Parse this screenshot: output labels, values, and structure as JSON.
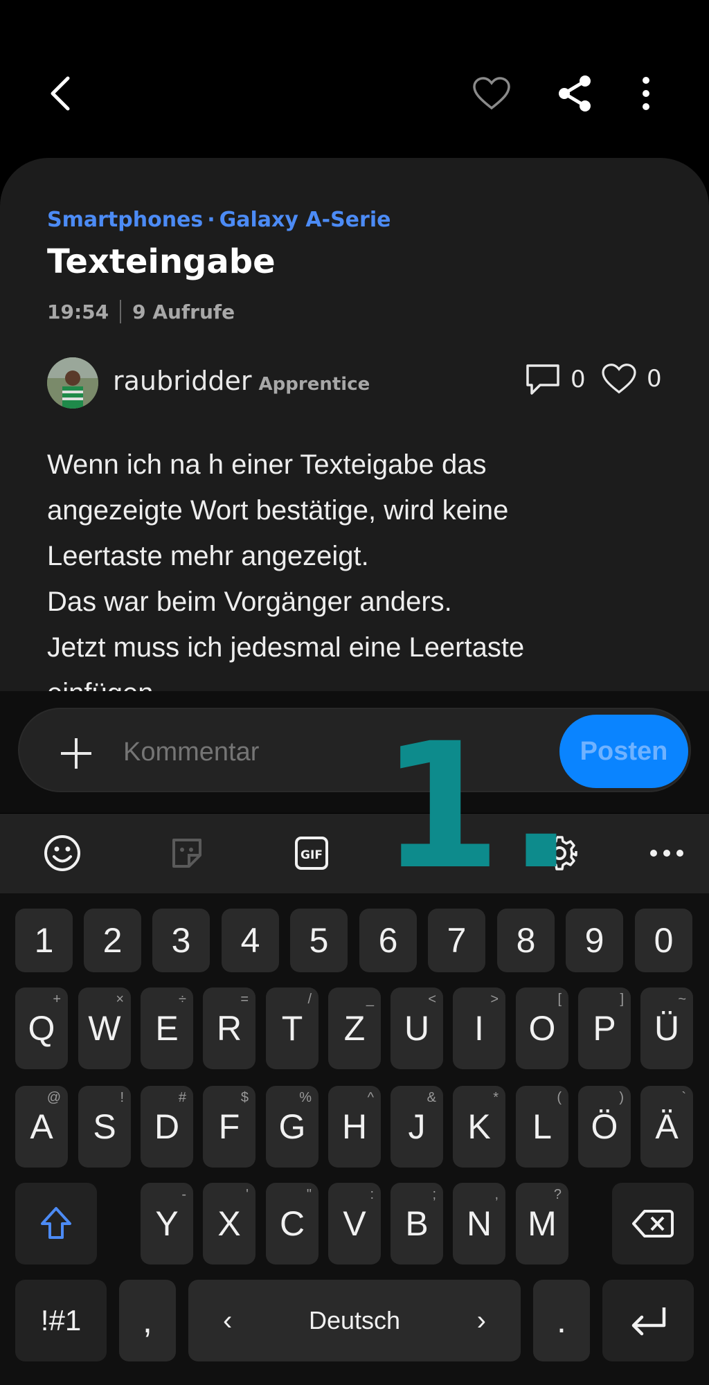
{
  "header": {
    "back_icon": "chevron-left-icon",
    "favorite_icon": "heart-outline-icon",
    "share_icon": "share-icon",
    "more_icon": "more-vertical-icon"
  },
  "post": {
    "breadcrumb": [
      "Smartphones",
      "Galaxy A-Serie"
    ],
    "breadcrumb_separator": "·",
    "title": "Texteingabe",
    "time": "19:54",
    "views": "9 Aufrufe",
    "author": {
      "name": "raubridder",
      "rank": "Apprentice"
    },
    "comments_count": "0",
    "likes_count": "0",
    "body_lines": [
      "Wenn ich na h einer Texteigabe das",
      "angezeigte Wort bestätige, wird keine",
      "Leertaste mehr angezeigt.",
      "Das war beim Vorgänger anders.",
      "Jetzt muss ich jedesmal eine Leertaste",
      "einfügen."
    ]
  },
  "comment_bar": {
    "placeholder": "Kommentar",
    "post_label": "Posten"
  },
  "annotation": "1.",
  "keyboard": {
    "toolbar": [
      "emoji-icon",
      "sticker-icon",
      "gif-icon",
      "settings-icon",
      "more-horizontal-icon"
    ],
    "gif_label": "GIF",
    "number_row": [
      "1",
      "2",
      "3",
      "4",
      "5",
      "6",
      "7",
      "8",
      "9",
      "0"
    ],
    "row1": [
      {
        "k": "Q",
        "s": "+"
      },
      {
        "k": "W",
        "s": "×"
      },
      {
        "k": "E",
        "s": "÷"
      },
      {
        "k": "R",
        "s": "="
      },
      {
        "k": "T",
        "s": "/"
      },
      {
        "k": "Z",
        "s": "_"
      },
      {
        "k": "U",
        "s": "<"
      },
      {
        "k": "I",
        "s": ">"
      },
      {
        "k": "O",
        "s": "["
      },
      {
        "k": "P",
        "s": "]"
      },
      {
        "k": "Ü",
        "s": "~"
      }
    ],
    "row2": [
      {
        "k": "A",
        "s": "@"
      },
      {
        "k": "S",
        "s": "!"
      },
      {
        "k": "D",
        "s": "#"
      },
      {
        "k": "F",
        "s": "$"
      },
      {
        "k": "G",
        "s": "%"
      },
      {
        "k": "H",
        "s": "^"
      },
      {
        "k": "J",
        "s": "&"
      },
      {
        "k": "K",
        "s": "*"
      },
      {
        "k": "L",
        "s": "("
      },
      {
        "k": "Ö",
        "s": ")"
      },
      {
        "k": "Ä",
        "s": "`"
      }
    ],
    "row3": [
      {
        "k": "Y",
        "s": "-"
      },
      {
        "k": "X",
        "s": "'"
      },
      {
        "k": "C",
        "s": "\""
      },
      {
        "k": "V",
        "s": ":"
      },
      {
        "k": "B",
        "s": ";"
      },
      {
        "k": "N",
        "s": ","
      },
      {
        "k": "M",
        "s": "?"
      }
    ],
    "symbols_label": "!#1",
    "comma_label": ",",
    "space_label": "Deutsch",
    "space_left": "‹",
    "space_right": "›",
    "period_label": ".",
    "accent_color": "#4c8bf5",
    "button_color": "#0a84ff",
    "annotation_color": "#0d8b8c"
  }
}
